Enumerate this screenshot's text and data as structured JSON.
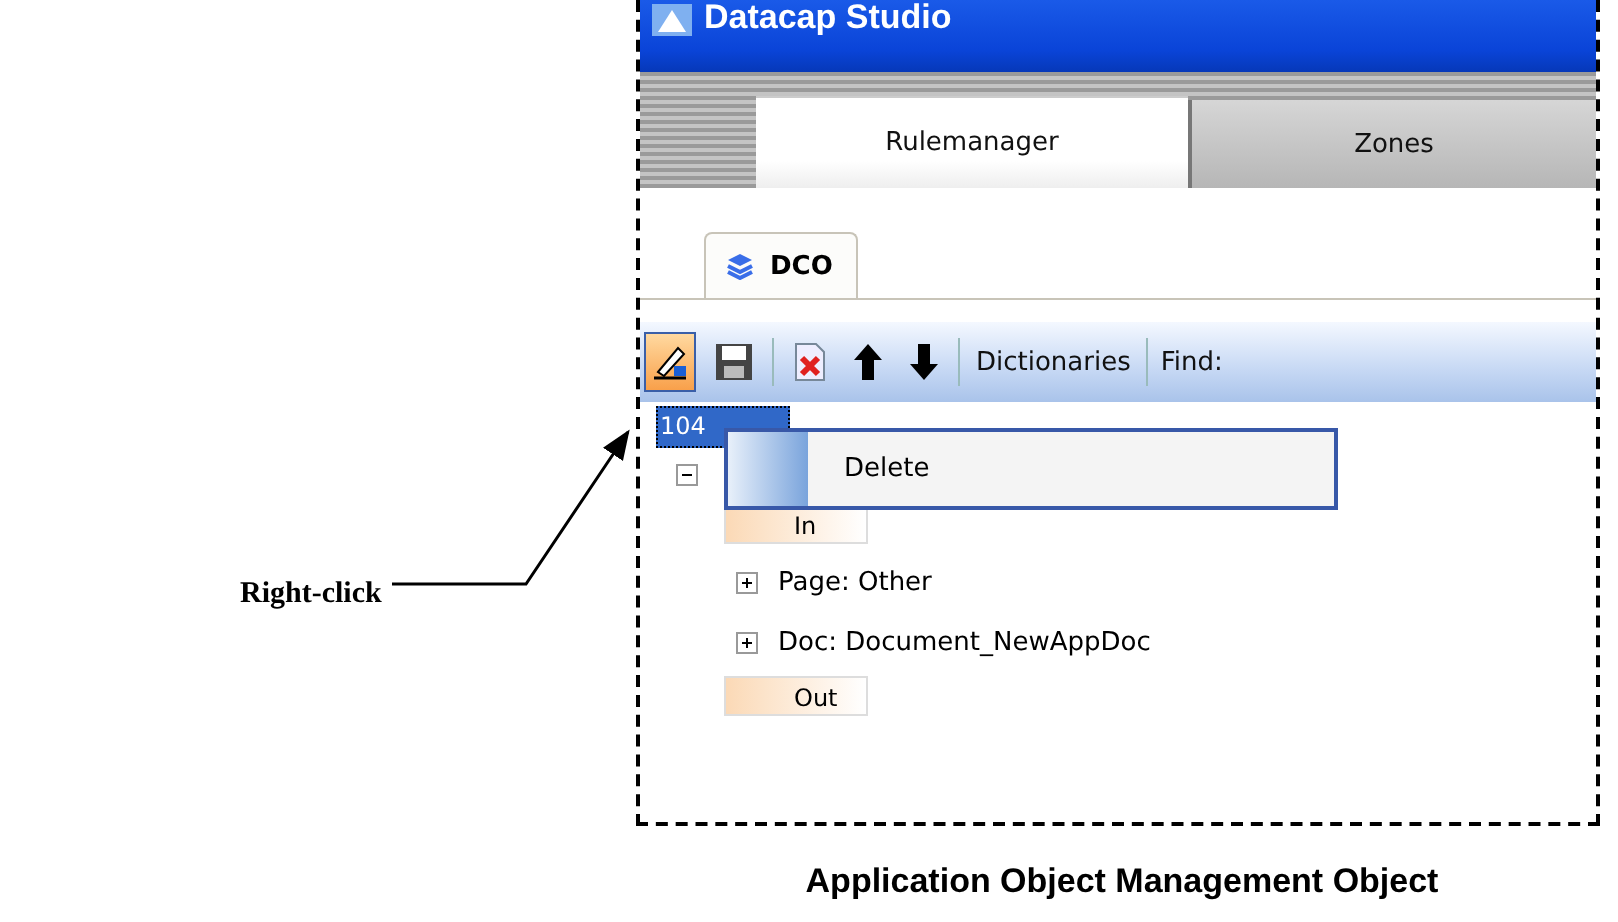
{
  "annotation": {
    "label": "Right-click"
  },
  "window": {
    "title": "Datacap Studio"
  },
  "tabs": [
    {
      "label": "Rulemanager",
      "selected": true
    },
    {
      "label": "Zones",
      "selected": false
    }
  ],
  "doc_tabs": [
    {
      "label": "DCO",
      "selected": true
    }
  ],
  "toolbar": [
    {
      "kind": "edit",
      "selected": true
    },
    {
      "kind": "save",
      "selected": false
    },
    {
      "kind": "separator"
    },
    {
      "kind": "delete",
      "selected": false
    },
    {
      "kind": "up",
      "selected": false
    },
    {
      "kind": "down",
      "selected": false
    },
    {
      "kind": "separator"
    },
    {
      "kind": "text",
      "label": "Dictionaries"
    },
    {
      "kind": "separator"
    },
    {
      "kind": "label",
      "label": "Find:"
    }
  ],
  "tree": [
    {
      "kind": "node",
      "label": "104",
      "selected": true,
      "expanded": true,
      "children": [
        {
          "kind": "port",
          "label": "In"
        },
        {
          "kind": "node",
          "label": "Page: Other",
          "expanded": false
        },
        {
          "kind": "node",
          "label": "Doc: Document_NewAppDoc",
          "expanded": false
        },
        {
          "kind": "port",
          "label": "Out"
        }
      ]
    }
  ],
  "context_menu": {
    "items": [
      {
        "label": "Delete"
      }
    ]
  },
  "caption": "Application Object Management Object"
}
